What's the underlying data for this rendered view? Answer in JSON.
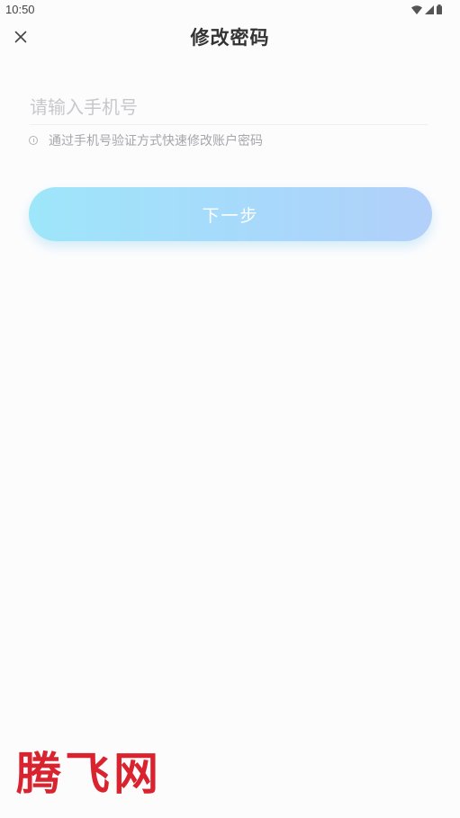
{
  "status_bar": {
    "time": "10:50",
    "icons": [
      "wifi-icon",
      "cellular-signal-icon",
      "battery-icon"
    ]
  },
  "header": {
    "title": "修改密码",
    "close_icon": "close-icon"
  },
  "form": {
    "phone_placeholder": "请输入手机号",
    "phone_value": "",
    "hint_icon": "info-icon",
    "hint": "通过手机号验证方式快速修改账户密码"
  },
  "next_button": {
    "label": "下一步",
    "gradient_start": "#9ee6fa",
    "gradient_end": "#b2d0fa"
  },
  "watermark": {
    "text": "腾飞网",
    "color": "#d9232f"
  }
}
